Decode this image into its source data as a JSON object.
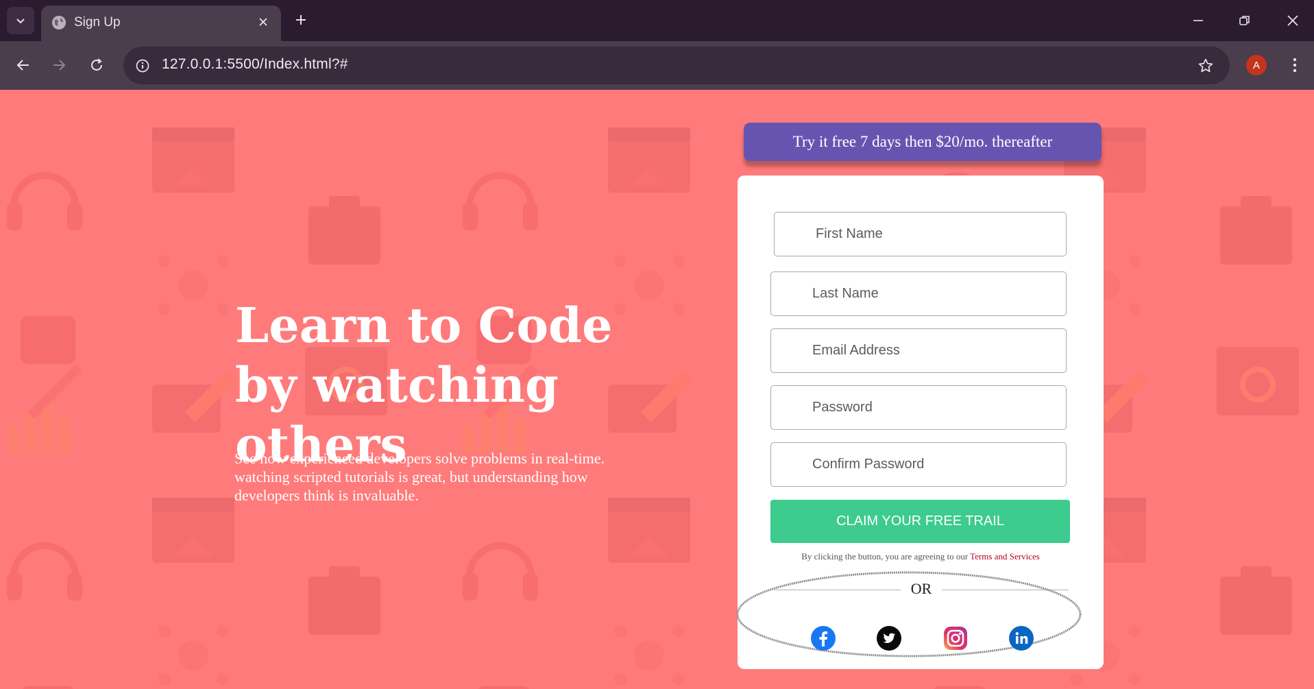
{
  "browser": {
    "tab_title": "Sign Up",
    "url": "127.0.0.1:5500/Index.html?#",
    "profile_initial": "A"
  },
  "hero": {
    "title": "Learn to Code by watching others",
    "description": "See how experienced developers solve problems in real-time. watching scripted tutorials is great, but understanding how developers think is invaluable."
  },
  "promo": {
    "text": "Try it free 7 days then $20/mo. thereafter"
  },
  "form": {
    "first_name_placeholder": "First Name",
    "last_name_placeholder": "Last Name",
    "email_placeholder": "Email Address",
    "password_placeholder": "Password",
    "confirm_password_placeholder": "Confirm Password",
    "submit_label": "CLAIM YOUR FREE TRAIL",
    "terms_prefix": "By clicking the button, you are agreeing to our ",
    "terms_link": "Terms and Services",
    "or_label": "OR"
  },
  "social": [
    "facebook-icon",
    "twitter-icon",
    "instagram-icon",
    "linkedin-icon"
  ],
  "colors": {
    "background": "#ff7a7a",
    "promo": "#6655b0",
    "cta": "#3dcb8e",
    "terms_link": "#b3001b"
  }
}
